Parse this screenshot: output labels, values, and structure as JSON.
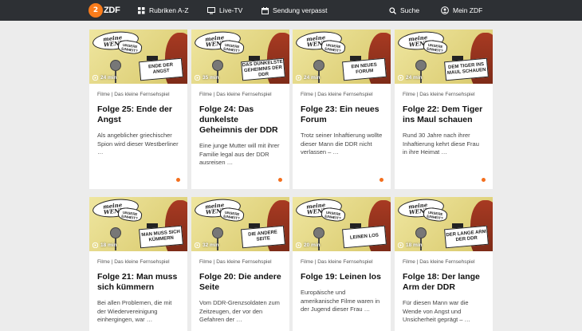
{
  "nav": {
    "logo": "ZDF",
    "rubriken": "Rubriken A-Z",
    "live": "Live-TV",
    "verpasst": "Sendung verpasst",
    "suche": "Suche",
    "mein": "Mein ZDF"
  },
  "thumb": {
    "bubble_line1": "meine",
    "bubble_line2": "WENDE",
    "bubble_small": "UNSERE EINHEIT?",
    "accent": "#f36f1e"
  },
  "cards": [
    {
      "duration": "24 min",
      "sign": "ENDE DER ANGST",
      "meta": "Filme | Das kleine Fernsehspiel",
      "title": "Folge 25: Ende der Angst",
      "desc": "Als angeblicher griechischer Spion wird dieser Westberliner …"
    },
    {
      "duration": "35 min",
      "sign": "DAS DUNKELSTE GEHEIMNIS DER DDR",
      "meta": "Filme | Das kleine Fernsehspiel",
      "title": "Folge 24: Das dunkelste Geheimnis der DDR",
      "desc": "Eine junge Mutter will mit ihrer Familie legal aus der DDR ausreisen …"
    },
    {
      "duration": "24 min",
      "sign": "EIN NEUES FORUM",
      "meta": "Filme | Das kleine Fernsehspiel",
      "title": "Folge 23: Ein neues Forum",
      "desc": "Trotz seiner Inhaftierung wollte dieser Mann die DDR nicht verlassen – …"
    },
    {
      "duration": "24 min",
      "sign": "DEM TIGER INS MAUL SCHAUEN",
      "meta": "Filme | Das kleine Fernsehspiel",
      "title": "Folge 22: Dem Tiger ins Maul schauen",
      "desc": "Rund 30 Jahre nach ihrer Inhaftierung kehrt diese Frau in ihre Heimat …"
    },
    {
      "duration": "18 min",
      "sign": "MAN MUSS SICH KÜMMERN",
      "meta": "Filme | Das kleine Fernsehspiel",
      "title": "Folge 21: Man muss sich kümmern",
      "desc": "Bei allen Problemen, die mit der Wiedervereinigung einhergingen, war …"
    },
    {
      "duration": "32 min",
      "sign": "DIE ANDERE SEITE",
      "meta": "Filme | Das kleine Fernsehspiel",
      "title": "Folge 20: Die andere Seite",
      "desc": "Vom DDR-Grenzsoldaten zum Zeitzeugen, der vor den Gefahren der …"
    },
    {
      "duration": "20 min",
      "sign": "LEINEN LOS",
      "meta": "Filme | Das kleine Fernsehspiel",
      "title": "Folge 19: Leinen los",
      "desc": "Europäische und amerikanische Filme waren in der Jugend dieser Frau …"
    },
    {
      "duration": "18 min",
      "sign": "DER LANGE ARM DER DDR",
      "meta": "Filme | Das kleine Fernsehspiel",
      "title": "Folge 18: Der lange Arm der DDR",
      "desc": "Für diesen Mann war die Wende von Angst und Unsicherheit geprägt – …"
    }
  ]
}
